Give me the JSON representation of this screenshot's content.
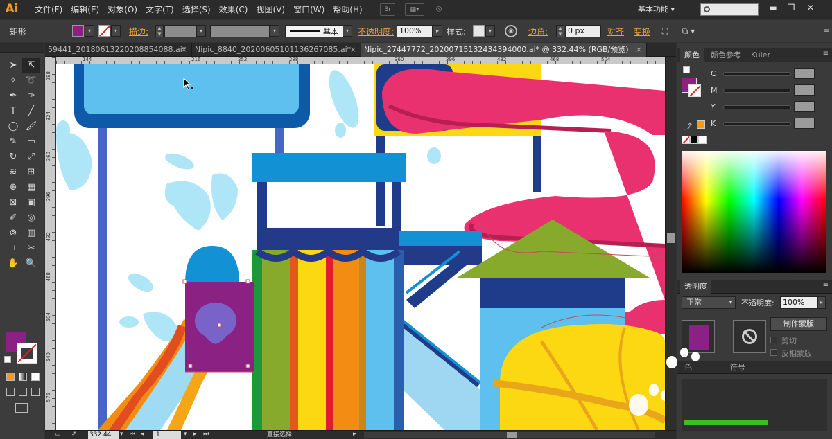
{
  "app": {
    "logo": "Ai",
    "menu": [
      "文件(F)",
      "编辑(E)",
      "对象(O)",
      "文字(T)",
      "选择(S)",
      "效果(C)",
      "视图(V)",
      "窗口(W)",
      "帮助(H)"
    ],
    "bridge_label": "Br",
    "workspace": "基本功能",
    "window_controls": [
      "▬",
      "❐",
      "✕"
    ]
  },
  "control_bar": {
    "object_type": "矩形",
    "stroke_label": "描边:",
    "stroke_style": "基本",
    "opacity_label": "不透明度:",
    "opacity_value": "100%",
    "style_label": "样式:",
    "corner_label": "边角:",
    "corner_value": "0 px",
    "align_label": "对齐",
    "transform_label": "变换",
    "fill_color": "#8b2183"
  },
  "tabs": [
    {
      "label": "59441_20180613220208854088.ai*",
      "active": false
    },
    {
      "label": "Nipic_8840_20200605101136267085.ai*",
      "active": false
    },
    {
      "label": "Nipic_27447772_20200715132434394000.ai* @ 332.44% (RGB/预览)",
      "active": true
    }
  ],
  "ruler": {
    "h_numbers": [
      "144",
      "216",
      "252",
      "288",
      "360",
      "396",
      "432",
      "468",
      "504"
    ],
    "v_numbers": [
      "288",
      "324",
      "360",
      "396",
      "432",
      "468",
      "504",
      "540",
      "576"
    ]
  },
  "status": {
    "zoom": "332.44",
    "page": "1",
    "tool": "直接选择"
  },
  "color_panel": {
    "tabs": [
      "颜色",
      "颜色参考",
      "Kuler"
    ],
    "channels": [
      "C",
      "M",
      "Y",
      "K"
    ],
    "fill_color": "#8b2183",
    "out_of_gamut_color": "#f29b22"
  },
  "transparency_panel": {
    "title": "透明度",
    "blend_mode": "正常",
    "opacity_label": "不透明度:",
    "opacity_value": "100%",
    "make_mask": "制作蒙版",
    "clip": "剪切",
    "invert_mask": "反相蒙版",
    "bottom_tabs": [
      "色",
      "符号"
    ]
  },
  "colors": {
    "accent_orange": "#e8a23b",
    "sky_blue": "#5ec0ef",
    "navy": "#1f3c8a",
    "magenta": "#ea3170",
    "purple": "#8b2183",
    "green": "#87aa2c",
    "yellow": "#fcd812"
  }
}
